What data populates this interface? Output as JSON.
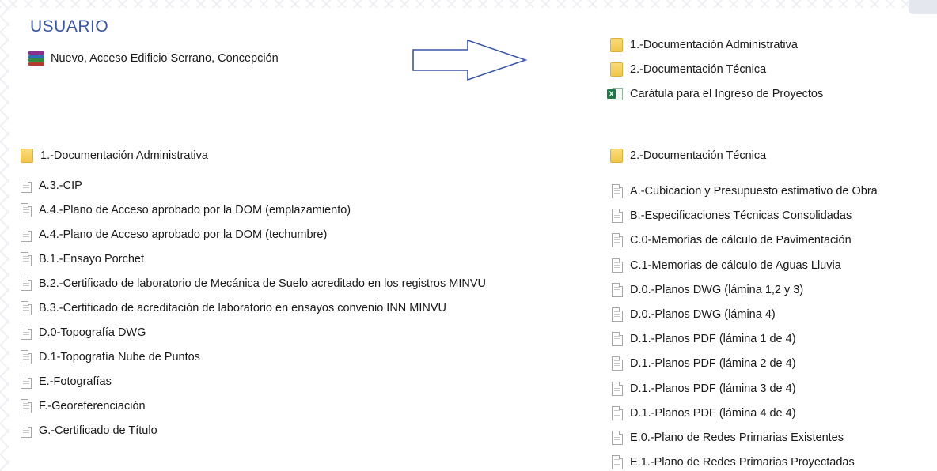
{
  "header": {
    "title": "USUARIO"
  },
  "archive": {
    "name": "Nuevo, Acceso Edificio Serrano, Concepción",
    "icon": "winrar-archive-icon"
  },
  "archive_contents": [
    {
      "type": "folder",
      "label": "1.-Documentación Administrativa"
    },
    {
      "type": "folder",
      "label": "2.-Documentación Técnica"
    },
    {
      "type": "excel",
      "label": "Carátula para el Ingreso de Proyectos",
      "badge": "X"
    }
  ],
  "admin_section": {
    "folder_label": "1.-Documentación Administrativa",
    "files": [
      "A.3.-CIP",
      "A.4.-Plano de Acceso aprobado por la DOM (emplazamiento)",
      "A.4.-Plano de Acceso aprobado por la DOM (techumbre)",
      "B.1.-Ensayo Porchet",
      "B.2.-Certificado de laboratorio de Mecánica de Suelo acreditado en los registros MINVU",
      "B.3.-Certificado de acreditación de laboratorio en ensayos convenio INN MINVU",
      "D.0-Topografía DWG",
      "D.1-Topografía Nube de Puntos",
      "E.-Fotografías",
      "F.-Georeferenciación",
      "G.-Certificado de Título"
    ]
  },
  "tech_section": {
    "folder_label": "2.-Documentación Técnica",
    "files": [
      "A.-Cubicacion y Presupuesto estimativo de Obra",
      "B.-Especificaciones Técnicas Consolidadas",
      "C.0-Memorias de cálculo de Pavimentación",
      "C.1-Memorias de cálculo de Aguas Lluvia",
      "D.0.-Planos DWG (lámina 1,2 y 3)",
      "D.0.-Planos DWG (lámina 4)",
      "D.1.-Planos PDF (lámina 1 de 4)",
      "D.1.-Planos PDF (lámina 2 de 4)",
      "D.1.-Planos PDF (lámina 3 de 4)",
      "D.1.-Planos PDF (lámina 4 de 4)",
      "E.0.-Plano de Redes Primarias Existentes",
      "E.1.-Plano de Redes Primarias Proyectadas"
    ]
  },
  "colors": {
    "title": "#3b57a8",
    "arrow": "#3b57a8",
    "folder": "#f1c54a",
    "excel": "#1d7a45"
  }
}
